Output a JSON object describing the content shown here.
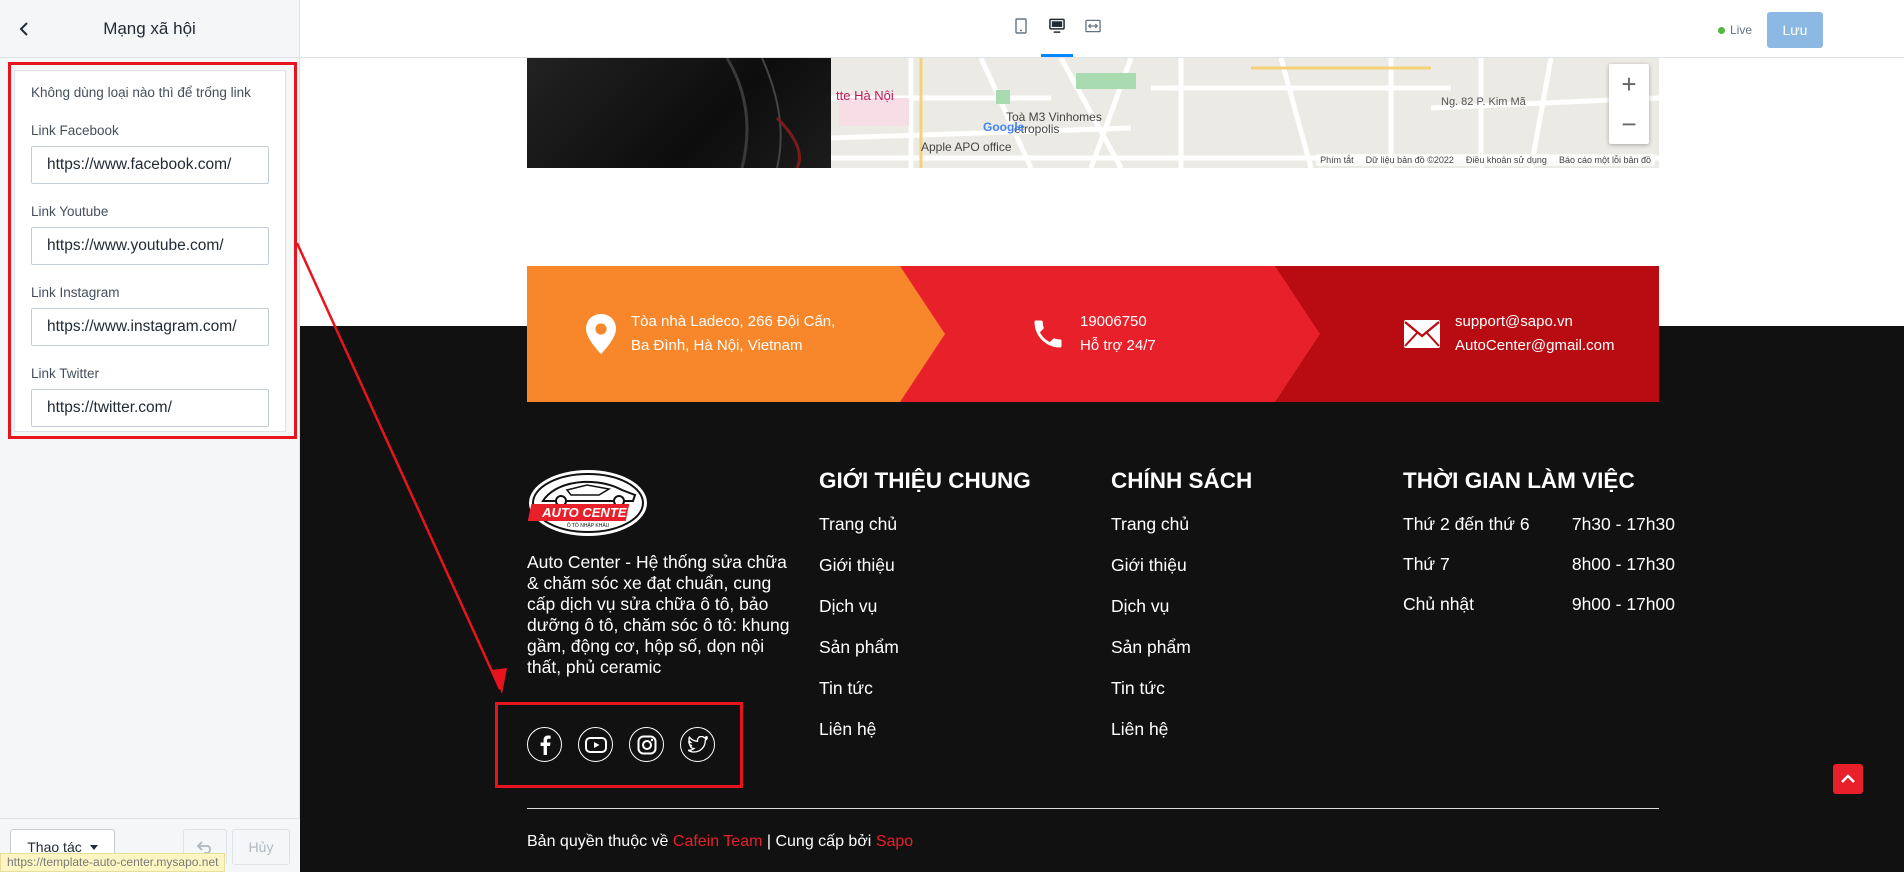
{
  "panel": {
    "title": "Mạng xã hội",
    "hint": "Không dùng loại nào thì để trống link",
    "fields": [
      {
        "label": "Link Facebook",
        "value": "https://www.facebook.com/"
      },
      {
        "label": "Link Youtube",
        "value": "https://www.youtube.com/"
      },
      {
        "label": "Link Instagram",
        "value": "https://www.instagram.com/"
      },
      {
        "label": "Link Twitter",
        "value": "https://twitter.com/"
      }
    ],
    "actions_label": "Thao tác",
    "cancel_label": "Hủy",
    "status_url": "https://template-auto-center.mysapo.net"
  },
  "topbar": {
    "live_label": "Live",
    "save_label": "Lưu"
  },
  "map": {
    "labels": [
      "tte Hà Nội",
      "Toà M3 Vinhomes",
      "etropolis",
      "Apple APO office",
      "Ng. 82 P. Kim Mã",
      "Google"
    ],
    "attribution": [
      "Phím tắt",
      "Dữ liệu bản đồ ©2022",
      "Điều khoản sử dụng",
      "Báo cáo một lỗi bản đồ"
    ],
    "zoom_in": "+",
    "zoom_out": "−"
  },
  "contact": {
    "address_line1": "Tòa nhà Ladeco, 266 Đội Cấn,",
    "address_line2": "Ba Đình, Hà Nội, Vietnam",
    "phone": "19006750",
    "phone_sub": "Hỗ trợ 24/7",
    "email1": "support@sapo.vn",
    "email2": "AutoCenter@gmail.com"
  },
  "footer": {
    "logo_text": "AUTO CENTER",
    "logo_sub": "Ô TÔ NHẬP KHẨU",
    "about": "Auto Center - Hệ thống sửa chữa & chăm sóc xe đạt chuẩn, cung cấp dịch vụ sửa chữa ô tô, bảo dưỡng ô tô, chăm sóc ô tô: khung gầm, động cơ, hộp số, dọn nội thất, phủ ceramic",
    "col1": {
      "title": "GIỚI THIỆU CHUNG",
      "links": [
        "Trang chủ",
        "Giới thiệu",
        "Dịch vụ",
        "Sản phẩm",
        "Tin tức",
        "Liên hệ"
      ]
    },
    "col2": {
      "title": "CHÍNH SÁCH",
      "links": [
        "Trang chủ",
        "Giới thiệu",
        "Dịch vụ",
        "Sản phẩm",
        "Tin tức",
        "Liên hệ"
      ]
    },
    "col3": {
      "title": "THỜI GIAN LÀM VIỆC",
      "rows": [
        {
          "day": "Thứ 2 đến thứ 6",
          "time": "7h30 - 17h30"
        },
        {
          "day": "Thứ 7",
          "time": "8h00 - 17h30"
        },
        {
          "day": "Chủ nhật",
          "time": "9h00 - 17h00"
        }
      ]
    },
    "copyright_prefix": "Bản quyền thuộc về",
    "copyright_team": "Cafein Team",
    "copyright_sep": "| Cung cấp bởi",
    "copyright_provider": "Sapo"
  },
  "colors": {
    "orange": "#f7872a",
    "red": "#e8202a",
    "darkred": "#b80c12",
    "highlight": "#e8141d",
    "save": "#8cb9e3"
  }
}
